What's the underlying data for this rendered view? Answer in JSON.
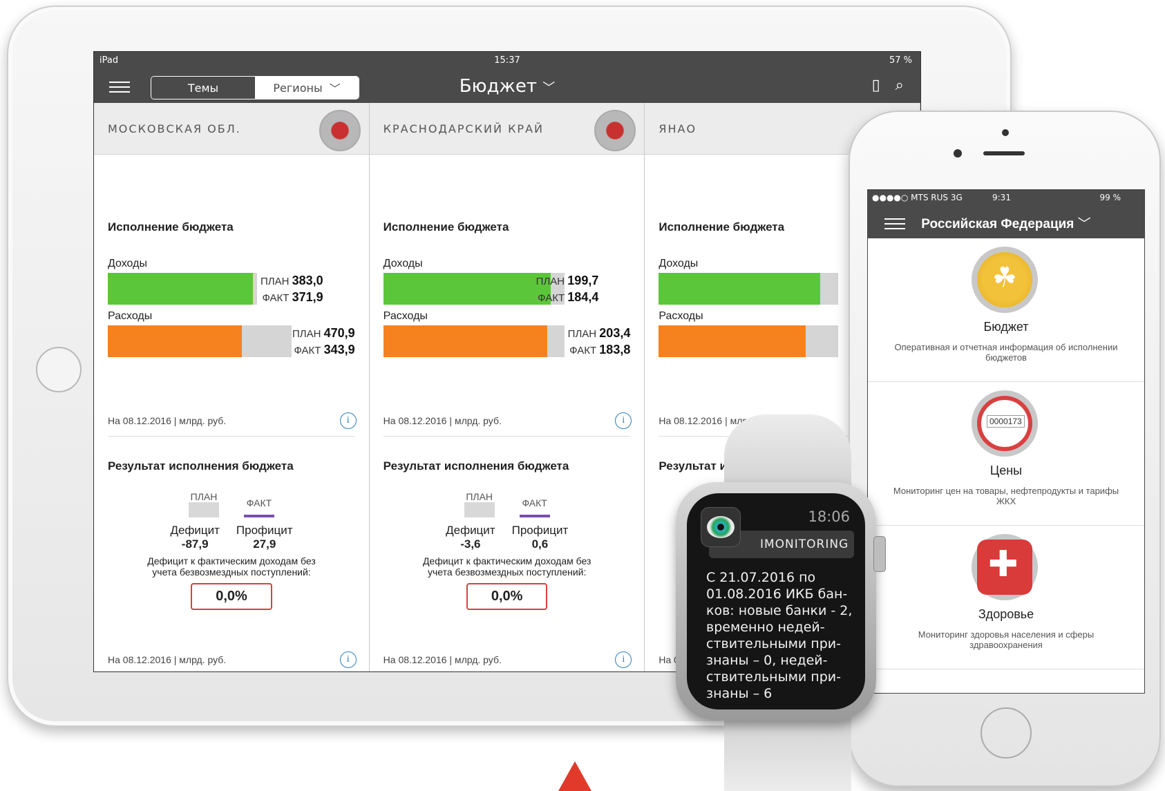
{
  "ipad": {
    "status": {
      "carrier": "iPad",
      "time": "15:37",
      "battery": "57 %"
    },
    "nav": {
      "themes_label": "Темы",
      "regions_label": "Регионы",
      "title": "Бюджет"
    },
    "columns": [
      {
        "region": "МОСКОВСКАЯ ОБЛ.",
        "exec_title": "Исполнение бюджета",
        "income_label": "Доходы",
        "income_plan": "383,0",
        "income_fact": "371,9",
        "income_fact_fraction": 0.971,
        "expense_label": "Расходы",
        "expense_plan": "470,9",
        "expense_fact": "343,9",
        "expense_fact_fraction": 0.73,
        "plan_word": "ПЛАН",
        "fact_word": "ФАКТ",
        "footer_date": "На 08.12.2016",
        "footer_unit": "млрд. руб.",
        "result_title": "Результат исполнения бюджета",
        "deficit_label": "Дефицит",
        "surplus_label": "Профицит",
        "deficit_value": "-87,9",
        "surplus_value": "27,9",
        "ratio_text": "Дефицит к фактическим доходам без учета безвозмездных поступлений:",
        "ratio_value": "0,0%"
      },
      {
        "region": "КРАСНОДАРСКИЙ КРАЙ",
        "exec_title": "Исполнение бюджета",
        "income_label": "Доходы",
        "income_plan": "199,7",
        "income_fact": "184,4",
        "income_fact_fraction": 0.923,
        "expense_label": "Расходы",
        "expense_plan": "203,4",
        "expense_fact": "183,8",
        "expense_fact_fraction": 0.904,
        "plan_word": "ПЛАН",
        "fact_word": "ФАКТ",
        "footer_date": "На 08.12.2016",
        "footer_unit": "млрд. руб.",
        "result_title": "Результат исполнения бюджета",
        "deficit_label": "Дефицит",
        "surplus_label": "Профицит",
        "deficit_value": "-3,6",
        "surplus_value": "0,6",
        "ratio_text": "Дефицит к фактическим доходам без учета безвозмездных поступлений:",
        "ratio_value": "0,0%"
      },
      {
        "region": "ЯНАО",
        "exec_title": "Исполнение бюджета",
        "income_label": "Доходы",
        "expense_label": "Расходы",
        "footer_date": "На 08.12.2016",
        "footer_unit": "млрд. руб.",
        "result_title": "Результат ис"
      }
    ]
  },
  "iphone": {
    "status": {
      "carrier": "●●●●○ MTS RUS  3G",
      "time": "9:31",
      "battery": "99 %"
    },
    "title": "Российская Федерация",
    "items": [
      {
        "name": "Бюджет",
        "desc": "Оперативная и отчетная информация об исполнении бюджетов"
      },
      {
        "name": "Цены",
        "desc": "Мониторинг цен на товары, нефтепродукты и тарифы ЖКХ"
      },
      {
        "name": "Здоровье",
        "desc": "Мониторинг здоровья населения и сферы здравоохранения"
      }
    ]
  },
  "watch": {
    "time": "18:06",
    "app": "IMONITORING",
    "message": "С 21.07.2016 по 01.08.2016 ИКБ бан-ков: новые банки - 2, временно недей-ствительными при-знаны – 0, недей-ствительными при-знаны – 6"
  },
  "colors": {
    "income": "#5cc63a",
    "expense": "#f5821f",
    "bar_bg": "#d5d5d5",
    "fact_accent": "#7a4eb0",
    "ratio_border": "#d94040",
    "navbar": "#4a4a4a"
  }
}
